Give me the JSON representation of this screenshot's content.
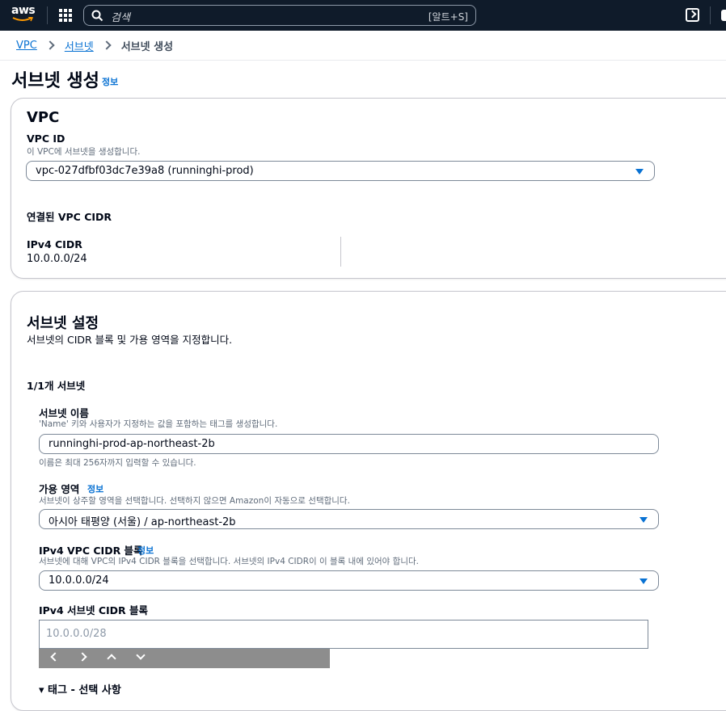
{
  "topnav": {
    "logo_text": "aws",
    "search_placeholder": "검색",
    "search_shortcut": "[알트+S]"
  },
  "breadcrumb": {
    "items": [
      "VPC",
      "서브넷"
    ],
    "current": "서브넷 생성"
  },
  "page": {
    "title": "서브넷 생성",
    "info_label": "정보"
  },
  "vpc_section": {
    "heading": "VPC",
    "vpc_id_label": "VPC ID",
    "vpc_id_desc": "이 VPC에 서브넷을 생성합니다.",
    "vpc_id_value": "vpc-027dfbf03dc7e39a8 (runninghi-prod)",
    "linked_cidr_heading": "연결된 VPC CIDR",
    "ipv4_cidr_label": "IPv4 CIDR",
    "ipv4_cidr_value": "10.0.0.0/24"
  },
  "subnet_settings": {
    "heading": "서브넷 설정",
    "desc": "서브넷의 CIDR 블록 및 가용 영역을 지정합니다.",
    "count_label": "1/1개 서브넷",
    "name_label": "서브넷 이름",
    "name_desc": "'Name' 키와 사용자가 지정하는 값을 포함하는 태그를 생성합니다.",
    "name_value": "runninghi-prod-ap-northeast-2b",
    "name_hint": "이름은 최대 256자까지 입력할 수 있습니다.",
    "az_label": "가용 영역",
    "az_info": "정보",
    "az_desc": "서브넷이 상주할 영역을 선택합니다. 선택하지 않으면 Amazon이 자동으로 선택합니다.",
    "az_value": "아시아 태평양 (서울) / ap-northeast-2b",
    "vpc_cidr_label": "IPv4 VPC CIDR 블록",
    "vpc_cidr_info": "정보",
    "vpc_cidr_desc": "서브넷에 대해 VPC의 IPv4 CIDR 블록을 선택합니다. 서브넷의 IPv4 CIDR이 이 블록 내에 있어야 합니다.",
    "vpc_cidr_value": "10.0.0.0/24",
    "subnet_cidr_label": "IPv4 서브넷 CIDR 블록",
    "subnet_cidr_placeholder": "10.0.0.0/28",
    "tags_label": "▾ 태그 - 선택 사항"
  },
  "colors": {
    "nav_bg": "#0f1b2a",
    "link": "#0972d3",
    "text": "#000716",
    "secondary_text": "#5f6b7a",
    "border": "#7d8998"
  }
}
